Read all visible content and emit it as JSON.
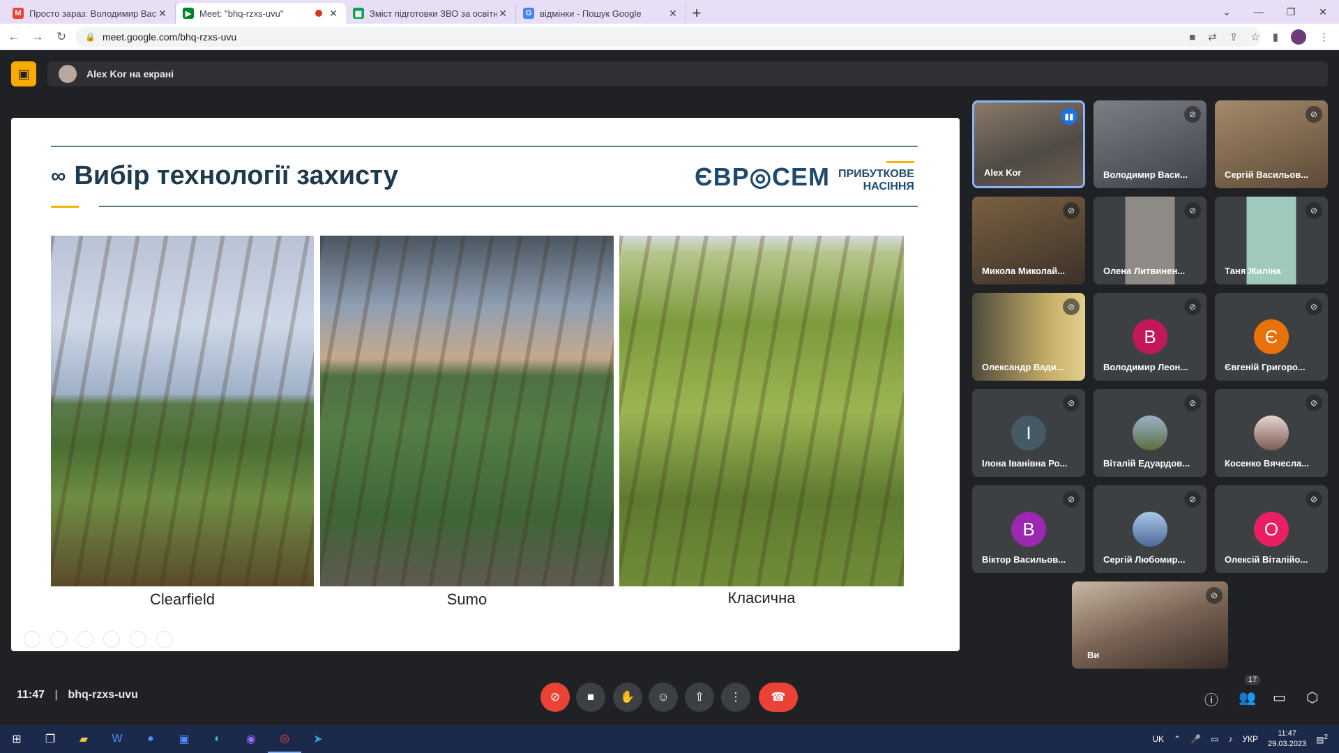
{
  "browser": {
    "tabs": [
      {
        "title": "Просто зараз: Володимир Васи...",
        "favicon": "gmail-icon",
        "color": "#ea4335"
      },
      {
        "title": "Meet: \"bhq-rzxs-uvu\"",
        "favicon": "meet-icon",
        "color": "#00832d",
        "active": true
      },
      {
        "title": "Зміст підготовки ЗВО за освітні...",
        "favicon": "sheets-icon",
        "color": "#0f9d58"
      },
      {
        "title": "відмінки - Пошук Google",
        "favicon": "google-icon",
        "color": "#4285f4"
      }
    ],
    "url": "meet.google.com/bhq-rzxs-uvu"
  },
  "meet": {
    "presenter": "Alex Kor на екрані",
    "slide": {
      "title": "Вибір технології захисту",
      "logo": "ЄВР◎СЕМ",
      "logo_sub1": "ПРИБУТКОВЕ",
      "logo_sub2": "НАСІННЯ",
      "captions": [
        "Clearfield",
        "Sumo",
        "Класична"
      ]
    },
    "participants": [
      {
        "name": "Alex Kor",
        "type": "video",
        "speaking": true
      },
      {
        "name": "Володимир Васи...",
        "type": "video",
        "muted": true
      },
      {
        "name": "Сергій Васильов...",
        "type": "video",
        "muted": true
      },
      {
        "name": "Микола Миколай...",
        "type": "video",
        "muted": true
      },
      {
        "name": "Олена Литвинен...",
        "type": "video",
        "muted": true
      },
      {
        "name": "Таня Жиліна",
        "type": "video",
        "muted": true
      },
      {
        "name": "Олександр Вади...",
        "type": "video",
        "muted": true
      },
      {
        "name": "Володимир Леон...",
        "type": "letter",
        "letter": "В",
        "color": "#c2185b",
        "muted": true
      },
      {
        "name": "Євгеній Григоро...",
        "type": "letter",
        "letter": "Є",
        "color": "#e8710a",
        "muted": true
      },
      {
        "name": "Ілона Іванівна Ро...",
        "type": "letter",
        "letter": "І",
        "color": "#455a64",
        "muted": true
      },
      {
        "name": "Віталій Едуардов...",
        "type": "photo",
        "muted": true
      },
      {
        "name": "Косенко Вячесла...",
        "type": "photo",
        "muted": true
      },
      {
        "name": "Віктор Васильов...",
        "type": "letter",
        "letter": "В",
        "color": "#9c27b0",
        "muted": true
      },
      {
        "name": "Сергій Любомир...",
        "type": "photo",
        "muted": true
      },
      {
        "name": "Олексій Віталійо...",
        "type": "letter",
        "letter": "О",
        "color": "#e91e63",
        "muted": true
      }
    ],
    "self_tile_name": "Ви",
    "time": "11:47",
    "meeting_code": "bhq-rzxs-uvu",
    "people_count": "17"
  },
  "taskbar": {
    "lang_short": "UK",
    "lang": "УКР",
    "clock_time": "11:47",
    "clock_date": "29.03.2023",
    "notif_count": "2"
  }
}
